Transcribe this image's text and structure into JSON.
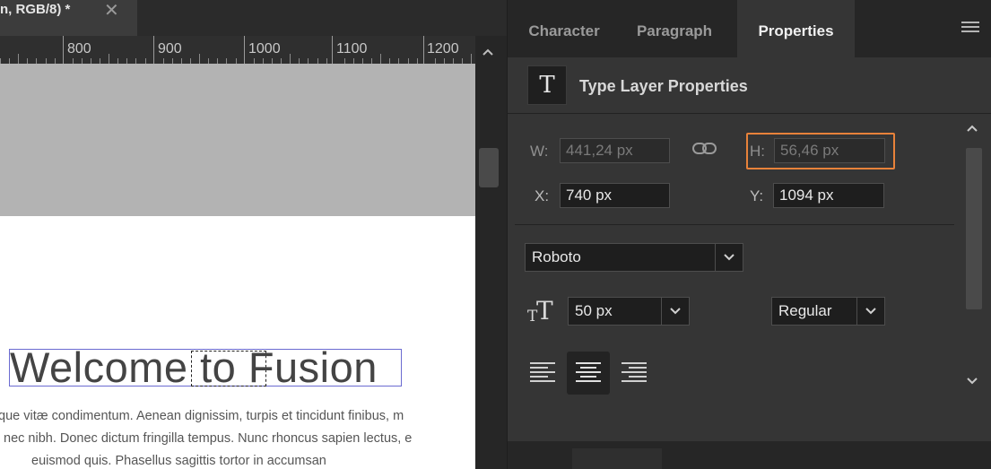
{
  "document": {
    "tab_title": "n, RGB/8) *",
    "ruler_labels": [
      "800",
      "900",
      "1000",
      "1100",
      "1200"
    ],
    "heading": "Welcome to Fusion",
    "body_lines": [
      "que vitæ condimentum. Aenean dignissim, turpis et tincidunt finibus, m",
      "nec nibh. Donec dictum fringilla tempus. Nunc rhoncus sapien lectus, e",
      "euismod quis. Phasellus sagittis tortor in accumsan"
    ]
  },
  "panel": {
    "tabs": [
      "Character",
      "Paragraph",
      "Properties"
    ],
    "active_tab": "Properties",
    "header_title": "Type Layer Properties",
    "fields": {
      "w_label": "W:",
      "w_value": "441,24 px",
      "h_label": "H:",
      "h_value": "56,46 px",
      "x_label": "X:",
      "x_value": "740 px",
      "y_label": "Y:",
      "y_value": "1094 px"
    },
    "font_family": "Roboto",
    "font_size": "50 px",
    "font_style": "Regular"
  },
  "colors": {
    "highlight": "#e8823a",
    "selection": "#6b6bd1"
  }
}
